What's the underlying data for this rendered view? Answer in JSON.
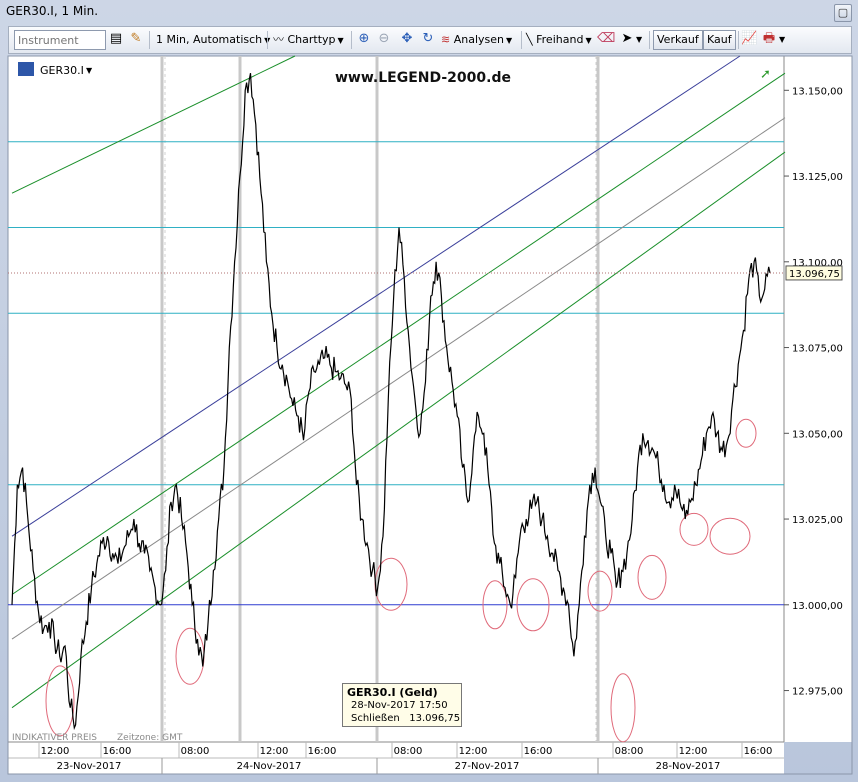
{
  "window": {
    "title": "GER30.I, 1 Min."
  },
  "toolbar": {
    "instrument_placeholder": "Instrument",
    "interval": "1 Min,",
    "mode": "Automatisch",
    "charttype": "Charttyp",
    "analysen": "Analysen",
    "freihand": "Freihand",
    "verkauf": "Verkauf",
    "kauf": "Kauf"
  },
  "chart_header": {
    "symbol": "GER30.I",
    "watermark": "www.LEGEND-2000.de"
  },
  "colors": {
    "price": "#000000",
    "channel_green": "#1a8f2a",
    "channel_blue": "#3a3f9a",
    "channel_gray": "#8a8a8a",
    "hline_teal": "#2fb0c4",
    "hline_blue": "#2f3bd0",
    "circle": "#e06a7a"
  },
  "footer": {
    "indicative": "INDIKATIVER PREIS",
    "timezone": "Zeitzone: GMT"
  },
  "infobox": {
    "title": "GER30.I (Geld)",
    "datetime": "28-Nov-2017 17:50",
    "close_label": "Schließen",
    "close_value": "13.096,75"
  },
  "chart_data": {
    "type": "line",
    "title": "GER30.I, 1 Min.",
    "ylim": [
      12960,
      13160
    ],
    "yticks": [
      {
        "value": 12975,
        "label": "12.975,00"
      },
      {
        "value": 13000,
        "label": "13.000,00"
      },
      {
        "value": 13025,
        "label": "13.025,00"
      },
      {
        "value": 13050,
        "label": "13.050,00"
      },
      {
        "value": 13075,
        "label": "13.075,00"
      },
      {
        "value": 13100,
        "label": "13.100,00"
      },
      {
        "value": 13125,
        "label": "13.125,00"
      },
      {
        "value": 13150,
        "label": "13.150,00"
      }
    ],
    "last_price": {
      "value": 13096.75,
      "label": "13.096,75"
    },
    "time_ticks": [
      "12:00",
      "16:00",
      "08:00",
      "12:00",
      "16:00",
      "08:00",
      "12:00",
      "16:00",
      "08:00",
      "12:00",
      "16:00"
    ],
    "dates": [
      "23-Nov-2017",
      "24-Nov-2017",
      "27-Nov-2017",
      "28-Nov-2017"
    ],
    "horizontal_levels": [
      {
        "value": 13135,
        "color": "teal"
      },
      {
        "value": 13110,
        "color": "teal"
      },
      {
        "value": 13085,
        "color": "teal"
      },
      {
        "value": 13035,
        "color": "teal"
      },
      {
        "value": 13000,
        "color": "blue"
      }
    ],
    "series": [
      {
        "values": [
          13000,
          13035,
          13040,
          13025,
          13010,
          12998,
          12993,
          12995,
          12990,
          12985,
          12988,
          12970,
          12965,
          12985,
          12995,
          13005,
          13012,
          13018,
          13020,
          13015,
          13012,
          13016,
          13020,
          13025,
          13018,
          13015,
          13010,
          13005,
          13000,
          13010,
          13030,
          13035,
          13025,
          13015,
          13000,
          12990,
          12982,
          12995,
          13010,
          13025,
          13040,
          13075,
          13100,
          13125,
          13150,
          13155,
          13140,
          13120,
          13100,
          13085,
          13075,
          13070,
          13065,
          13058,
          13055,
          13048,
          13062,
          13068,
          13070,
          13072,
          13070,
          13068,
          13066,
          13064,
          13060,
          13035,
          13025,
          13018,
          13010,
          13005,
          13020,
          13060,
          13090,
          13110,
          13095,
          13075,
          13060,
          13050,
          13065,
          13090,
          13100,
          13090,
          13075,
          13065,
          13055,
          13040,
          13030,
          13045,
          13055,
          13050,
          13035,
          13018,
          13012,
          13005,
          13000,
          13008,
          13022,
          13025,
          13028,
          13030,
          13025,
          13020,
          13015,
          13010,
          13005,
          13000,
          12985,
          13000,
          13020,
          13035,
          13040,
          13030,
          13020,
          13015,
          13005,
          13010,
          13015,
          13025,
          13040,
          13050,
          13048,
          13045,
          13040,
          13035,
          13030,
          13035,
          13030,
          13025,
          13030,
          13035,
          13042,
          13050,
          13055,
          13050,
          13045,
          13048,
          13060,
          13070,
          13080,
          13095,
          13100,
          13090,
          13092,
          13096.75
        ],
        "x_range": [
          12,
          770
        ]
      }
    ],
    "channels": [
      {
        "color": "green",
        "from": [
          12,
          13120
        ],
        "to": [
          295,
          13160
        ]
      },
      {
        "color": "blue",
        "from": [
          12,
          13020
        ],
        "to": [
          740,
          13160
        ]
      },
      {
        "color": "green",
        "from": [
          12,
          13003
        ],
        "to": [
          785,
          13155
        ]
      },
      {
        "color": "gray",
        "from": [
          12,
          12990
        ],
        "to": [
          785,
          13142
        ]
      },
      {
        "color": "green",
        "from": [
          12,
          12970
        ],
        "to": [
          785,
          13132
        ]
      }
    ],
    "circles": [
      {
        "x": 60,
        "y": 12972,
        "rx": 14,
        "ry": 35
      },
      {
        "x": 190,
        "y": 12985,
        "rx": 14,
        "ry": 28
      },
      {
        "x": 391,
        "y": 13006,
        "rx": 16,
        "ry": 26
      },
      {
        "x": 495,
        "y": 13000,
        "rx": 12,
        "ry": 24
      },
      {
        "x": 533,
        "y": 13000,
        "rx": 16,
        "ry": 26
      },
      {
        "x": 600,
        "y": 13004,
        "rx": 12,
        "ry": 20
      },
      {
        "x": 623,
        "y": 12970,
        "rx": 12,
        "ry": 34
      },
      {
        "x": 652,
        "y": 13008,
        "rx": 14,
        "ry": 22
      },
      {
        "x": 694,
        "y": 13022,
        "rx": 14,
        "ry": 16
      },
      {
        "x": 730,
        "y": 13020,
        "rx": 20,
        "ry": 18
      },
      {
        "x": 746,
        "y": 13050,
        "rx": 10,
        "ry": 14
      }
    ]
  }
}
